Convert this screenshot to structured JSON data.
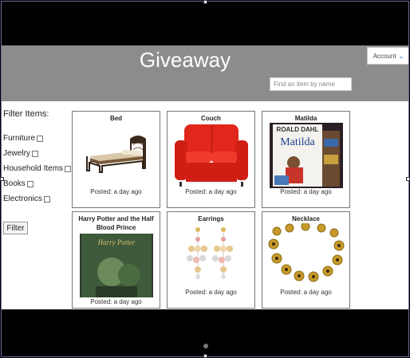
{
  "header": {
    "title": "Giveaway",
    "account_label": "Account",
    "search_placeholder": "Find an item by name"
  },
  "filters": {
    "heading": "Filter Items:",
    "options": [
      "Furniture",
      "Jewelry",
      "Household Items",
      "Books",
      "Electronics"
    ],
    "button_label": "Filter"
  },
  "items": [
    {
      "name": "Bed",
      "posted": "Posted: a day ago"
    },
    {
      "name": "Couch",
      "posted": "Posted: a day ago"
    },
    {
      "name": "Matilda",
      "posted": "Posted: a day ago"
    },
    {
      "name": "Harry Potter and the Half Blood Prince",
      "posted": "Posted: a day ago"
    },
    {
      "name": "Earrings",
      "posted": "Posted: a day ago"
    },
    {
      "name": "Necklace",
      "posted": "Posted: a day ago"
    }
  ],
  "book_covers": {
    "matilda_author": "ROALD DAHL",
    "matilda_title": "Matilda",
    "hp_title": "Harry Potter"
  },
  "colors": {
    "header_bg": "#8c8c8c",
    "couch_red": "#e1261c",
    "accent_blue": "#1e5db3"
  }
}
